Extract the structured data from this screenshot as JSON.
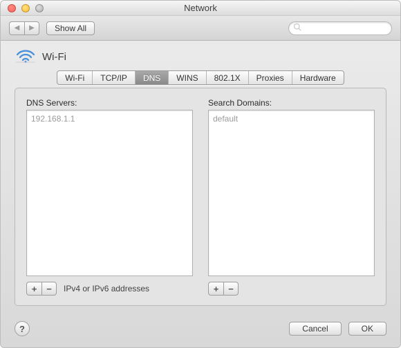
{
  "window": {
    "title": "Network"
  },
  "toolbar": {
    "show_all_label": "Show All",
    "search_placeholder": ""
  },
  "section": {
    "title": "Wi-Fi"
  },
  "tabs": [
    {
      "label": "Wi-Fi",
      "active": false
    },
    {
      "label": "TCP/IP",
      "active": false
    },
    {
      "label": "DNS",
      "active": true
    },
    {
      "label": "WINS",
      "active": false
    },
    {
      "label": "802.1X",
      "active": false
    },
    {
      "label": "Proxies",
      "active": false
    },
    {
      "label": "Hardware",
      "active": false
    }
  ],
  "dns_panel": {
    "servers_label": "DNS Servers:",
    "servers": [
      "192.168.1.1"
    ],
    "domains_label": "Search Domains:",
    "domains": [
      "default"
    ],
    "hint": "IPv4 or IPv6 addresses"
  },
  "buttons": {
    "plus": "+",
    "minus": "−",
    "help": "?",
    "cancel": "Cancel",
    "ok": "OK"
  }
}
